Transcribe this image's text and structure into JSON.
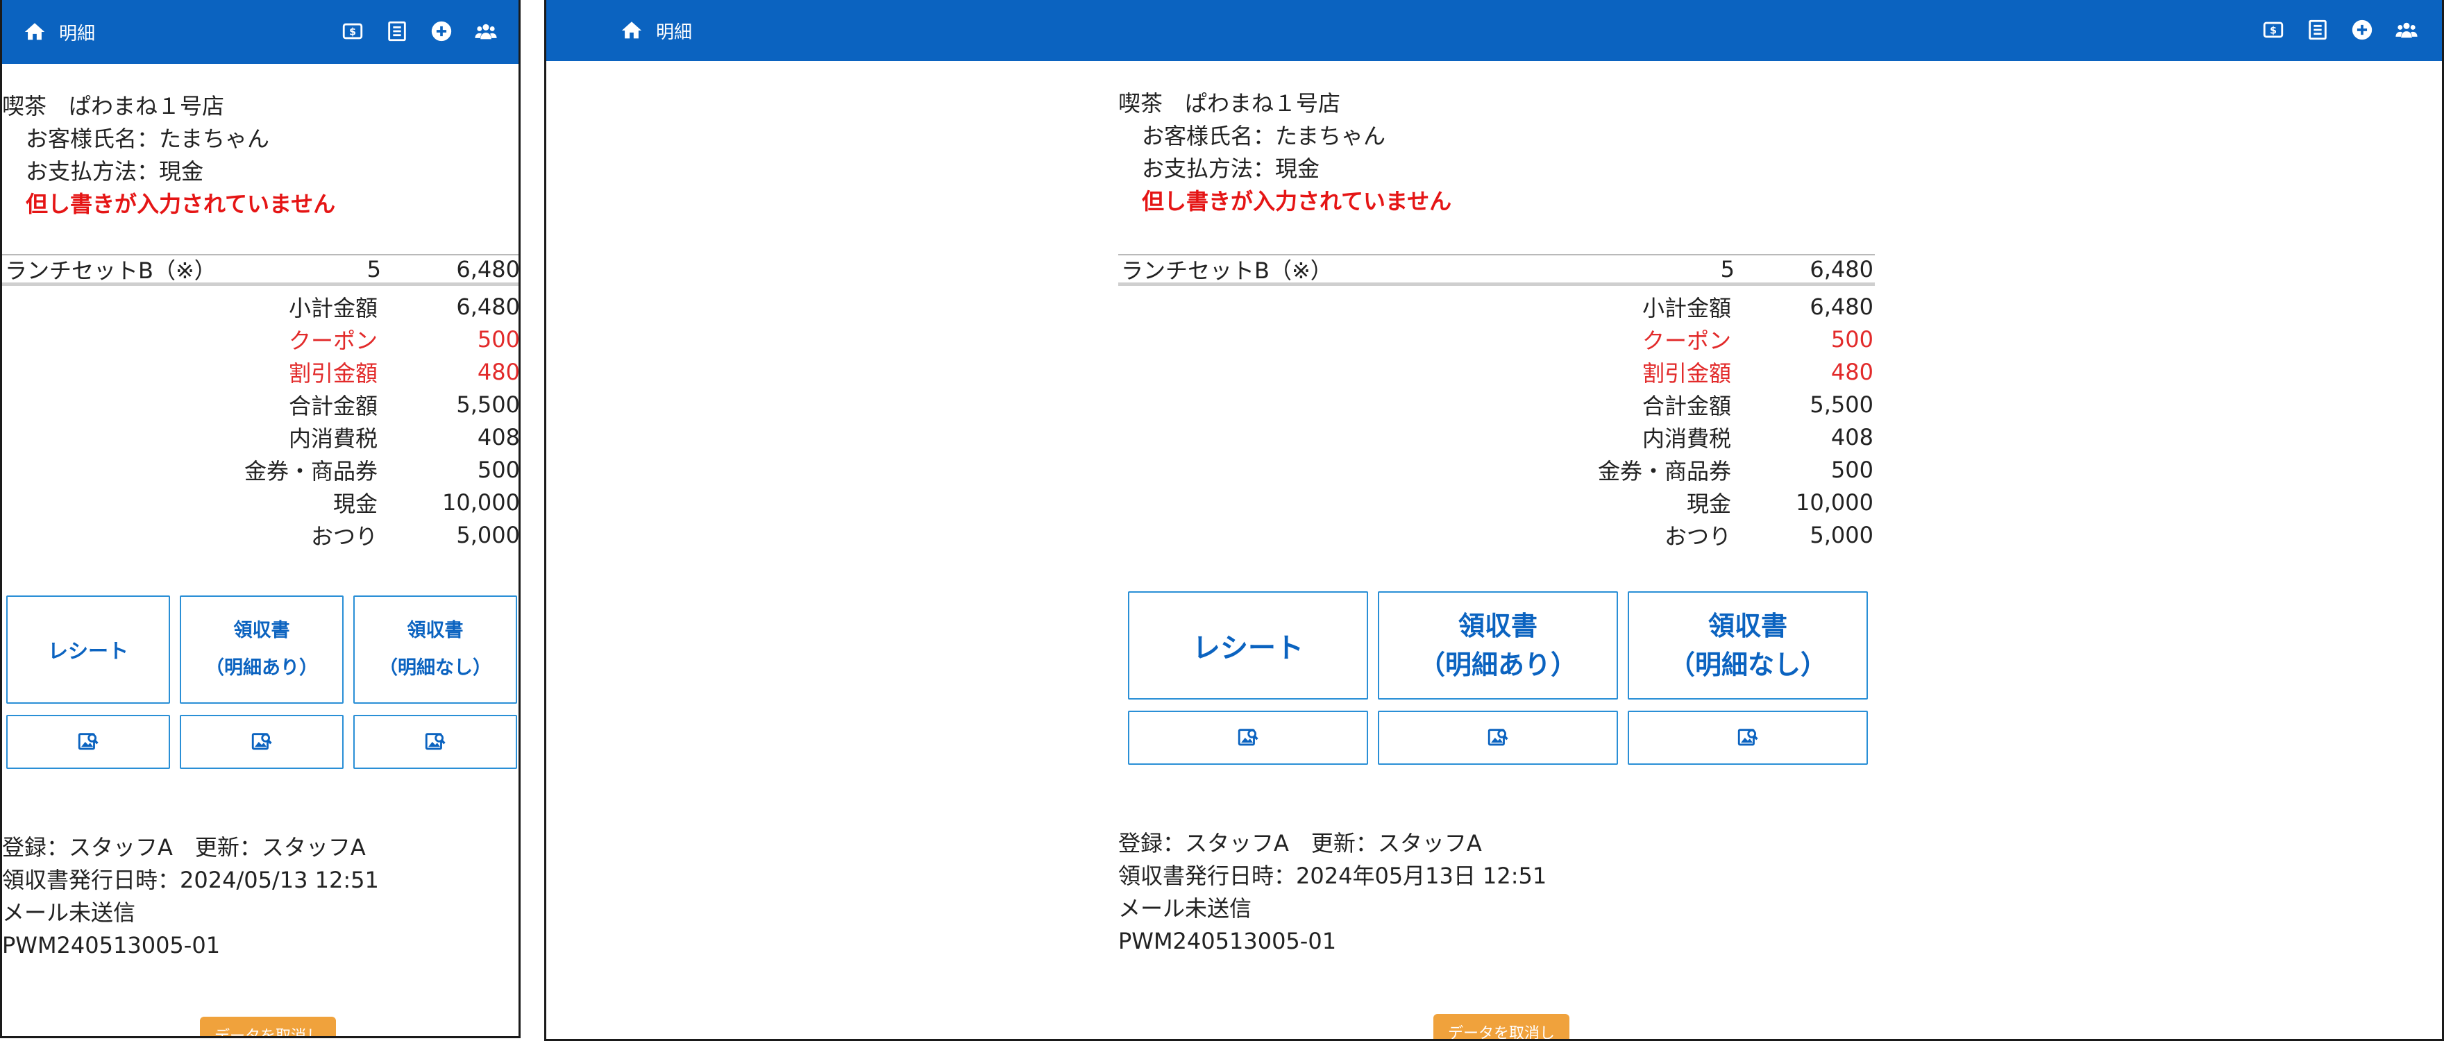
{
  "colors": {
    "header_bg": "#0b63c0",
    "accent": "#2a8fd6",
    "warning": "#e51515",
    "discount": "#e22a2a",
    "orange": "#f0a23c"
  },
  "header": {
    "title": "明細",
    "icons": [
      "home-icon",
      "cash-icon",
      "list-icon",
      "plus-circle-icon",
      "users-icon"
    ]
  },
  "left": {
    "shop": "喫茶　ぱわまね１号店",
    "customer": "お客様氏名：たまちゃん",
    "payment": "お支払方法：現金",
    "warning": "但し書きが入力されていません",
    "item": {
      "name": "ランチセットB（※）",
      "qty": "5",
      "price": "6,480"
    },
    "summary": [
      {
        "label": "小計金額",
        "value": "6,480"
      },
      {
        "label": "クーポン",
        "value": "500"
      },
      {
        "label": "割引金額",
        "value": "480"
      },
      {
        "label": "合計金額",
        "value": "5,500"
      },
      {
        "label": "内消費税",
        "value": "408"
      },
      {
        "label": "金券・商品券",
        "value": "500"
      },
      {
        "label": "現金",
        "value": "10,000"
      },
      {
        "label": "おつり",
        "value": "5,000"
      }
    ],
    "buttons": {
      "receipt": "レシート",
      "ryoshu": "領収書",
      "with_detail": "（明細あり）",
      "without_detail": "（明細なし）"
    },
    "footer": {
      "staff": "登録：スタッフA　更新：スタッフA",
      "issued": "領収書発行日時：2024/05/13 12:51",
      "mail": "メール未送信",
      "code": "PWM240513005-01"
    },
    "cancel": "データを取消し"
  },
  "right": {
    "shop": "喫茶　ぱわまね１号店",
    "customer": "お客様氏名：たまちゃん",
    "payment": "お支払方法：現金",
    "warning": "但し書きが入力されていません",
    "item": {
      "name": "ランチセットB（※）",
      "qty": "5",
      "price": "6,480"
    },
    "summary": [
      {
        "label": "小計金額",
        "value": "6,480"
      },
      {
        "label": "クーポン",
        "value": "500"
      },
      {
        "label": "割引金額",
        "value": "480"
      },
      {
        "label": "合計金額",
        "value": "5,500"
      },
      {
        "label": "内消費税",
        "value": "408"
      },
      {
        "label": "金券・商品券",
        "value": "500"
      },
      {
        "label": "現金",
        "value": "10,000"
      },
      {
        "label": "おつり",
        "value": "5,000"
      }
    ],
    "buttons": {
      "receipt": "レシート",
      "ryoshu": "領収書",
      "with_detail": "（明細あり）",
      "without_detail": "（明細なし）"
    },
    "footer": {
      "staff": "登録：スタッフA　更新：スタッフA",
      "issued": "領収書発行日時：2024年05月13日 12:51",
      "mail": "メール未送信",
      "code": "PWM240513005-01"
    },
    "cancel": "データを取消し"
  }
}
